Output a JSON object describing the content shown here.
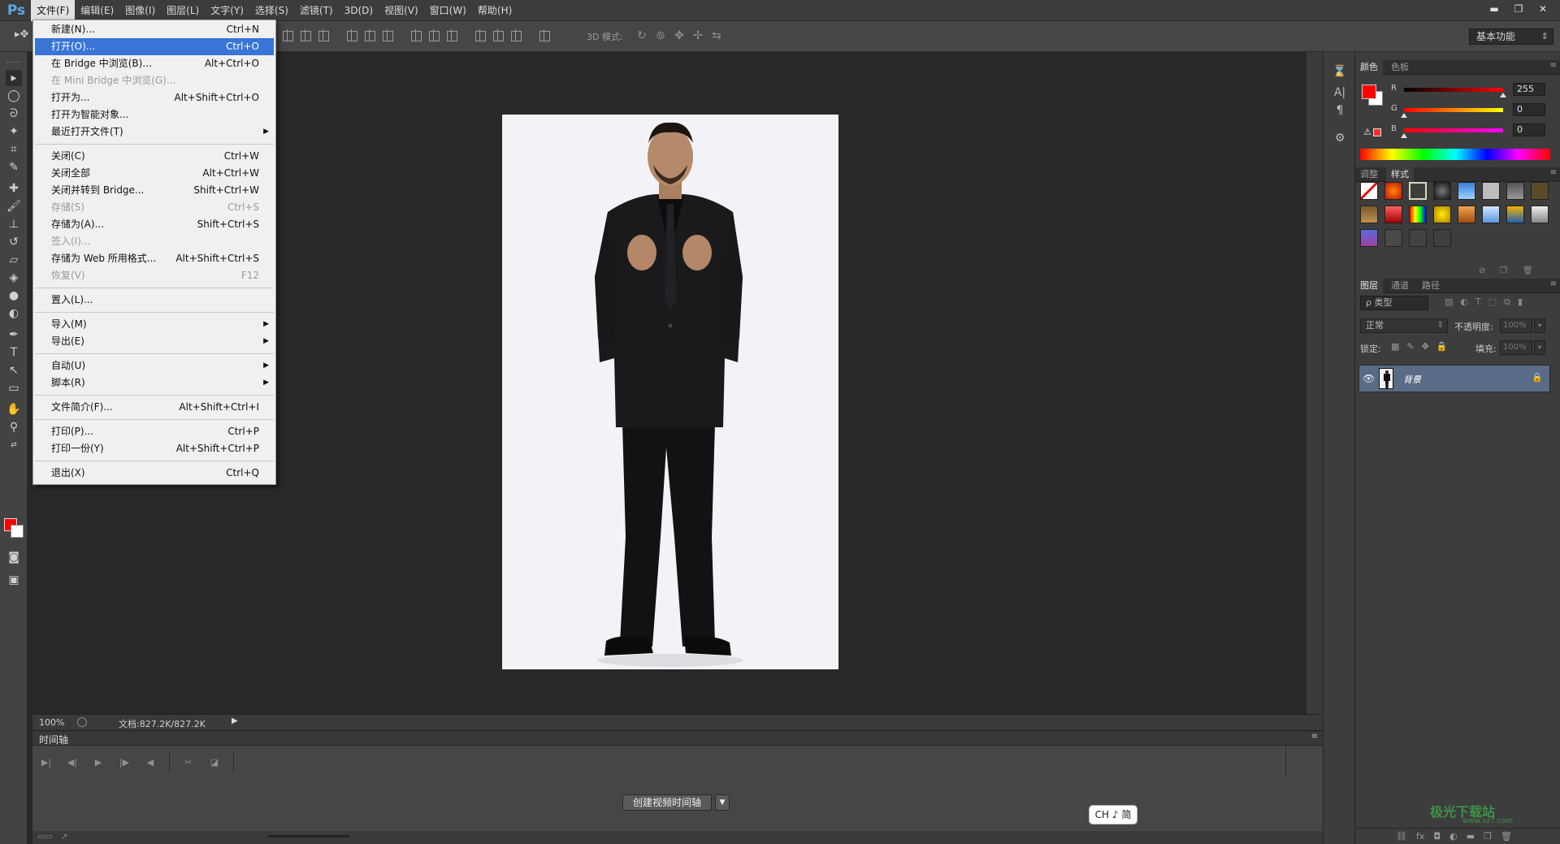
{
  "app": {
    "logo": "Ps"
  },
  "menubar": {
    "items": [
      "文件(F)",
      "编辑(E)",
      "图像(I)",
      "图层(L)",
      "文字(Y)",
      "选择(S)",
      "滤镜(T)",
      "3D(D)",
      "视图(V)",
      "窗口(W)",
      "帮助(H)"
    ],
    "active": "文件(F)"
  },
  "window_controls": {
    "minimize": "▬",
    "restore": "❐",
    "close": "✕"
  },
  "options": {
    "mode3d_label": "3D 模式:",
    "workspace": "基本功能"
  },
  "file_menu": {
    "items": [
      {
        "label": "新建(N)...",
        "shortcut": "Ctrl+N",
        "state": "normal"
      },
      {
        "label": "打开(O)...",
        "shortcut": "Ctrl+O",
        "state": "highlighted"
      },
      {
        "label": "在 Bridge 中浏览(B)...",
        "shortcut": "Alt+Ctrl+O",
        "state": "normal"
      },
      {
        "label": "在 Mini Bridge 中浏览(G)...",
        "shortcut": "",
        "state": "disabled"
      },
      {
        "label": "打开为...",
        "shortcut": "Alt+Shift+Ctrl+O",
        "state": "normal"
      },
      {
        "label": "打开为智能对象...",
        "shortcut": "",
        "state": "normal"
      },
      {
        "label": "最近打开文件(T)",
        "shortcut": "",
        "state": "submenu"
      },
      {
        "separator": true
      },
      {
        "label": "关闭(C)",
        "shortcut": "Ctrl+W",
        "state": "normal"
      },
      {
        "label": "关闭全部",
        "shortcut": "Alt+Ctrl+W",
        "state": "normal"
      },
      {
        "label": "关闭并转到 Bridge...",
        "shortcut": "Shift+Ctrl+W",
        "state": "normal"
      },
      {
        "label": "存储(S)",
        "shortcut": "Ctrl+S",
        "state": "disabled"
      },
      {
        "label": "存储为(A)...",
        "shortcut": "Shift+Ctrl+S",
        "state": "normal"
      },
      {
        "label": "签入(I)...",
        "shortcut": "",
        "state": "disabled"
      },
      {
        "label": "存储为 Web 所用格式...",
        "shortcut": "Alt+Shift+Ctrl+S",
        "state": "normal"
      },
      {
        "label": "恢复(V)",
        "shortcut": "F12",
        "state": "disabled"
      },
      {
        "separator": true
      },
      {
        "label": "置入(L)...",
        "shortcut": "",
        "state": "normal"
      },
      {
        "separator": true
      },
      {
        "label": "导入(M)",
        "shortcut": "",
        "state": "submenu"
      },
      {
        "label": "导出(E)",
        "shortcut": "",
        "state": "submenu"
      },
      {
        "separator": true
      },
      {
        "label": "自动(U)",
        "shortcut": "",
        "state": "submenu"
      },
      {
        "label": "脚本(R)",
        "shortcut": "",
        "state": "submenu"
      },
      {
        "separator": true
      },
      {
        "label": "文件简介(F)...",
        "shortcut": "Alt+Shift+Ctrl+I",
        "state": "normal"
      },
      {
        "separator": true
      },
      {
        "label": "打印(P)...",
        "shortcut": "Ctrl+P",
        "state": "normal"
      },
      {
        "label": "打印一份(Y)",
        "shortcut": "Alt+Shift+Ctrl+P",
        "state": "normal"
      },
      {
        "separator": true
      },
      {
        "label": "退出(X)",
        "shortcut": "Ctrl+Q",
        "state": "normal"
      }
    ]
  },
  "status": {
    "zoom": "100%",
    "doc_info": "文档:827.2K/827.2K"
  },
  "timeline": {
    "title": "时间轴",
    "create_button": "创建视频时间轴"
  },
  "ime": {
    "label": "CH ♪ 简"
  },
  "color_panel": {
    "tabs": [
      "颜色",
      "色板"
    ],
    "active_tab": "颜色",
    "r_label": "R",
    "g_label": "G",
    "b_label": "B",
    "r": "255",
    "g": "0",
    "b": "0",
    "foreground": "#ff0000",
    "background": "#ffffff"
  },
  "styles_panel": {
    "tabs": [
      "调整",
      "样式"
    ],
    "active_tab": "样式"
  },
  "layers_panel": {
    "tabs": [
      "图层",
      "通道",
      "路径"
    ],
    "active_tab": "图层",
    "filter": "ρ 类型",
    "blend_mode": "正常",
    "opacity_label": "不透明度:",
    "opacity": "100%",
    "lock_label": "锁定:",
    "fill_label": "填充:",
    "fill": "100%",
    "layers": [
      {
        "name": "背景",
        "visible": true,
        "locked": true
      }
    ]
  },
  "watermark": {
    "text": "极光下载站",
    "url": "www.xz7.com"
  }
}
